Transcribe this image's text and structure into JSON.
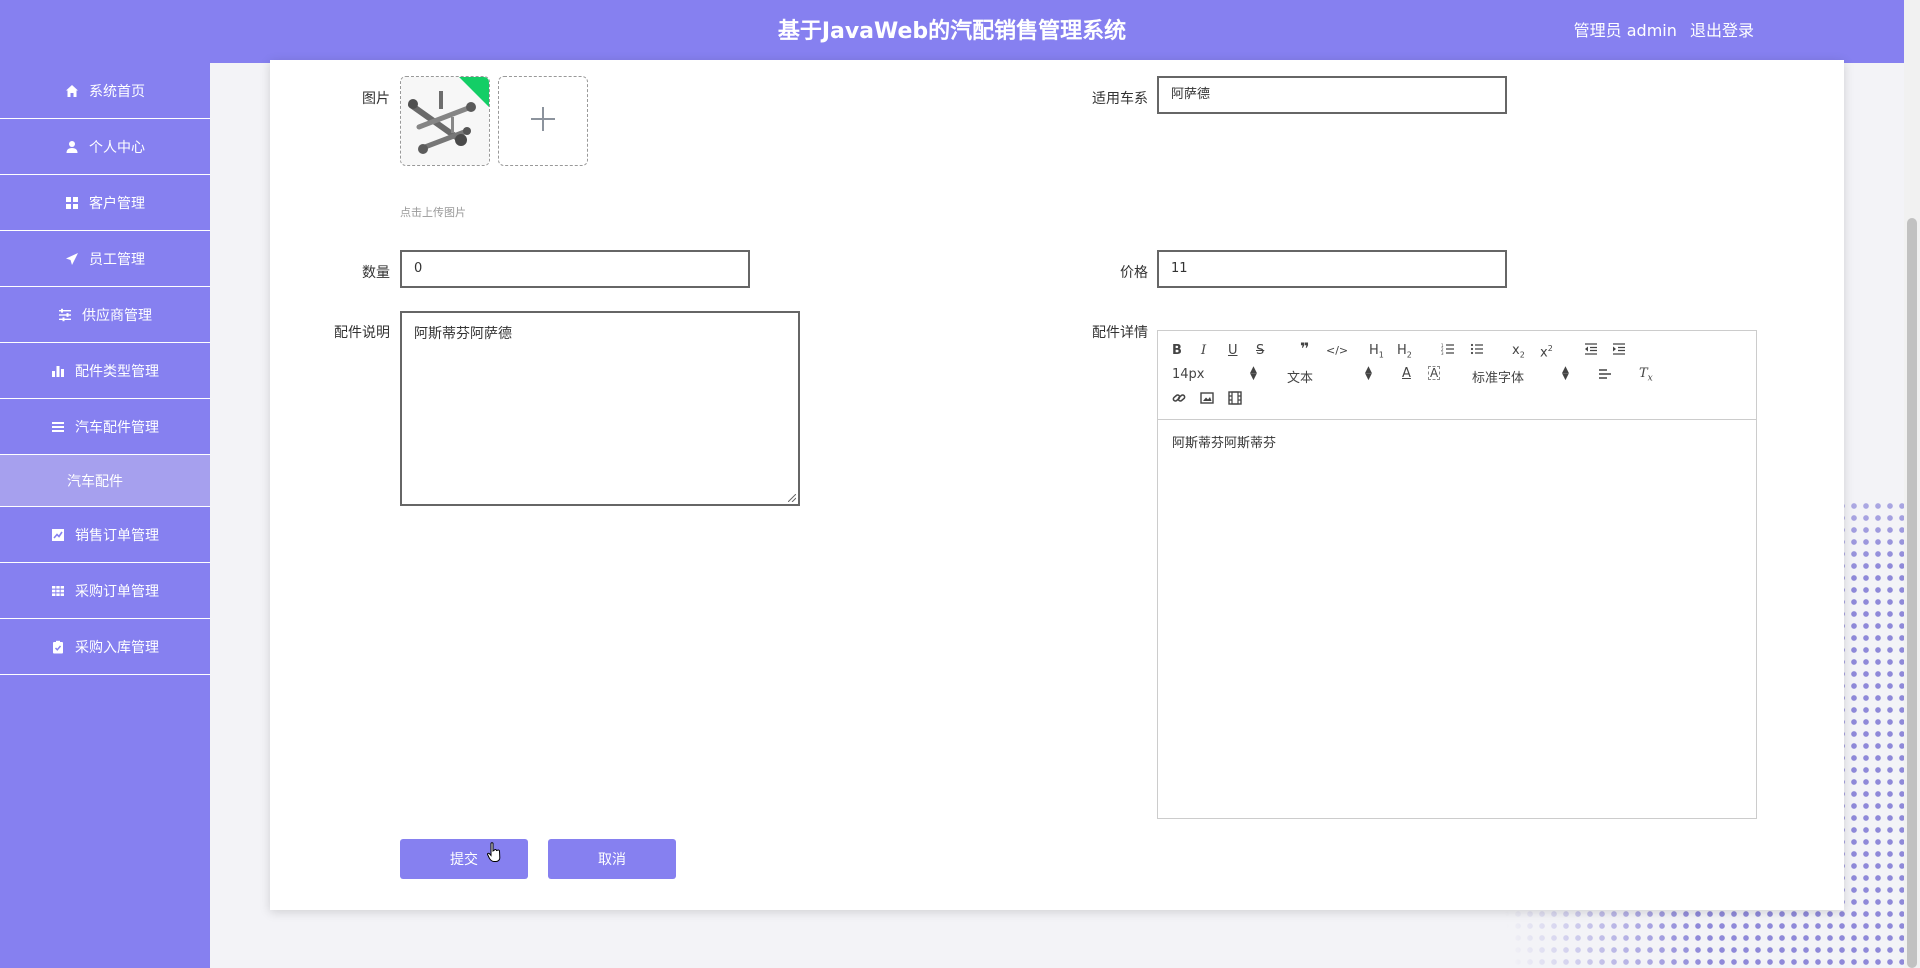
{
  "header": {
    "title": "基于JavaWeb的汽配销售管理系统",
    "user_label": "管理员 admin",
    "logout_label": "退出登录"
  },
  "sidebar": {
    "items": [
      {
        "label": "系统首页",
        "icon": "home-icon"
      },
      {
        "label": "个人中心",
        "icon": "user-icon"
      },
      {
        "label": "客户管理",
        "icon": "grid-icon"
      },
      {
        "label": "员工管理",
        "icon": "paper-plane-icon"
      },
      {
        "label": "供应商管理",
        "icon": "sliders-icon"
      },
      {
        "label": "配件类型管理",
        "icon": "bar-chart-icon"
      },
      {
        "label": "汽车配件管理",
        "icon": "list-icon"
      }
    ],
    "sub_item": "汽车配件",
    "items2": [
      {
        "label": "销售订单管理",
        "icon": "line-chart-icon"
      },
      {
        "label": "采购订单管理",
        "icon": "table-icon"
      },
      {
        "label": "采购入库管理",
        "icon": "clipboard-icon"
      }
    ]
  },
  "form": {
    "image_label": "图片",
    "upload_hint": "点击上传图片",
    "series_label": "适用车系",
    "series_value": "阿萨德",
    "quantity_label": "数量",
    "quantity_value": "0",
    "price_label": "价格",
    "price_value": "11",
    "desc_label": "配件说明",
    "desc_value": "阿斯蒂芬阿萨德",
    "detail_label": "配件详情"
  },
  "editor": {
    "font_size": "14px",
    "paragraph": "文本",
    "font_family": "标准字体",
    "content": "阿斯蒂芬阿斯蒂芬"
  },
  "buttons": {
    "submit": "提交",
    "cancel": "取消"
  },
  "colors": {
    "accent": "#8680f0",
    "sub_item_bg": "#a6a0ee"
  }
}
